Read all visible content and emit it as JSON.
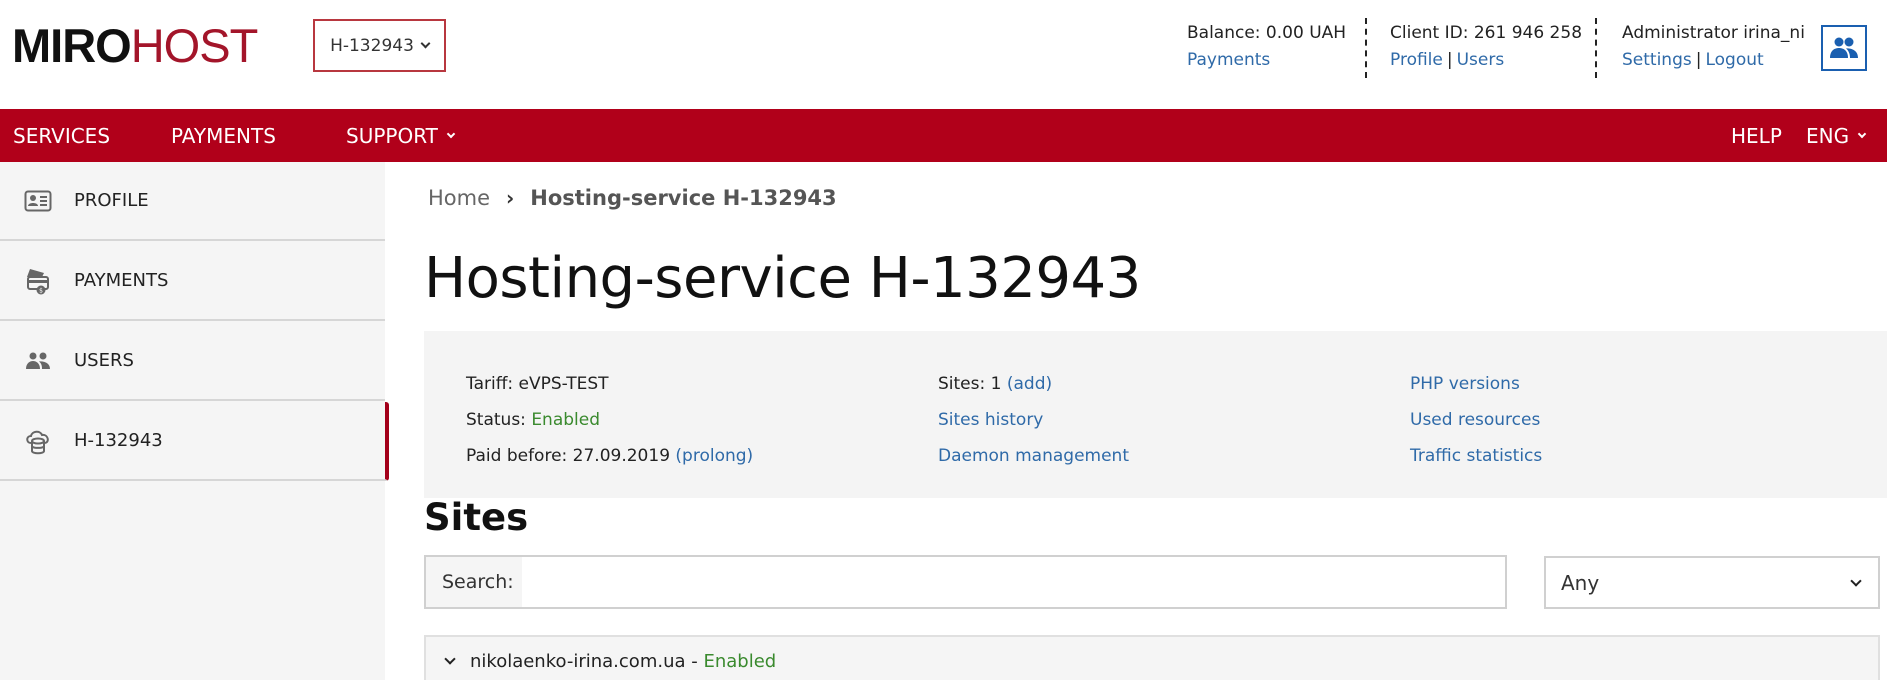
{
  "brand": {
    "part1": "MIRO",
    "part2": "HOST",
    "accent_color": "#a3152a"
  },
  "service_selector": {
    "value": "H-132943"
  },
  "account": {
    "balance_label": "Balance: 0.00 UAH",
    "balance_link": "Payments",
    "client_id_label": "Client ID: 261 946 258",
    "client_links": [
      "Profile",
      "Users"
    ],
    "user_label": "Administrator irina_ni",
    "user_links": [
      "Settings",
      "Logout"
    ],
    "link_separator": "|"
  },
  "nav": {
    "left": [
      {
        "label": "SERVICES"
      },
      {
        "label": "PAYMENTS"
      },
      {
        "label": "SUPPORT",
        "has_dropdown": true
      }
    ],
    "right": [
      {
        "label": "HELP"
      },
      {
        "label": "ENG",
        "has_dropdown": true
      }
    ],
    "background_color": "#b1001a"
  },
  "sidebar": {
    "items": [
      {
        "label": "PROFILE",
        "icon": "id-card-icon"
      },
      {
        "label": "PAYMENTS",
        "icon": "payment-card-icon"
      },
      {
        "label": "USERS",
        "icon": "users-icon"
      },
      {
        "label": "H-132943",
        "icon": "cloud-database-icon",
        "active": true
      }
    ]
  },
  "breadcrumb": {
    "home": "Home",
    "separator": "›",
    "current": "Hosting-service H-132943"
  },
  "page_title": "Hosting-service H-132943",
  "info": {
    "tariff_label": "Tariff:",
    "tariff_value": "eVPS-TEST",
    "status_label": "Status:",
    "status_value": "Enabled",
    "paid_label": "Paid before:",
    "paid_value": "27.09.2019",
    "prolong_link": "(prolong)",
    "sites_label": "Sites:",
    "sites_value": "1",
    "add_link": "(add)",
    "sites_history_link": "Sites history",
    "daemon_link": "Daemon management",
    "php_link": "PHP versions",
    "resources_link": "Used resources",
    "traffic_link": "Traffic statistics"
  },
  "sites": {
    "title": "Sites",
    "search_label": "Search:",
    "search_value": "",
    "search_placeholder": "",
    "filter_value": "Any",
    "list": [
      {
        "domain": "nikolaenko-irina.com.ua",
        "separator": " - ",
        "status": "Enabled"
      }
    ]
  },
  "colors": {
    "link": "#2f6aa8",
    "enabled": "#3a8a2e",
    "avatar_border": "#1a5fb0"
  }
}
